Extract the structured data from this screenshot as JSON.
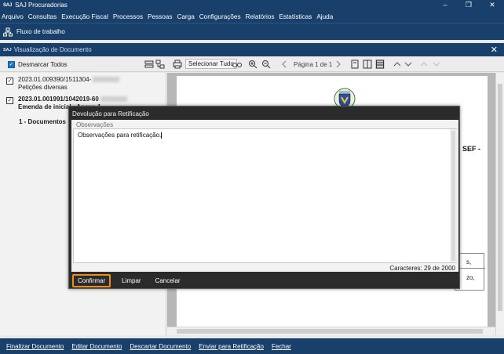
{
  "app": {
    "logo": "SAJ",
    "title": "SAJ Procuradorias",
    "window_controls": [
      "–",
      "❐",
      "✕"
    ]
  },
  "menu": [
    "Arquivo",
    "Consultas",
    "Execução Fiscal",
    "Processos",
    "Pessoas",
    "Carga",
    "Configurações",
    "Relatórios",
    "Estatísticas",
    "Ajuda"
  ],
  "quickbar": {
    "label": "Fluxo de trabalho",
    "icon": "workflow-icon"
  },
  "doc_window": {
    "logo": "SAJ",
    "title": "Visualização de Documento",
    "close": "✕"
  },
  "toolbar": {
    "deselect_all": "Desmarcar Todos",
    "select_all": "Selecionar Tudo",
    "page_info": "Página 1 de 1"
  },
  "documents": [
    {
      "line1": "2023.01.009390/1511304-",
      "line2": "Petições diversas",
      "checked": true,
      "bold": false
    },
    {
      "line1": "2023.01.001991/1042019-60",
      "line2": "Emenda de inicial - Anexo 1",
      "checked": true,
      "bold": true
    },
    {
      "line1": "1 - Documentos",
      "bold": true
    }
  ],
  "viewer": {
    "visible_text": [
      "SEF -",
      "s,",
      "zo,"
    ]
  },
  "dialog": {
    "title": "Devolução para Retificação",
    "group_label": "Observações",
    "text_value": "Observações para retificação.",
    "char_count": "Caracteres: 29 de 2000",
    "buttons": {
      "confirm": "Confirmar",
      "clear": "Limpar",
      "cancel": "Cancelar"
    }
  },
  "bottom_actions": [
    "Finalizar Documento",
    "Editar Documento",
    "Descartar Documento",
    "Enviar para Retificação",
    "Fechar"
  ],
  "colors": {
    "primary_dark": "#19406a",
    "accent_orange": "#f28c18",
    "checkbox_blue": "#1a73c9"
  }
}
